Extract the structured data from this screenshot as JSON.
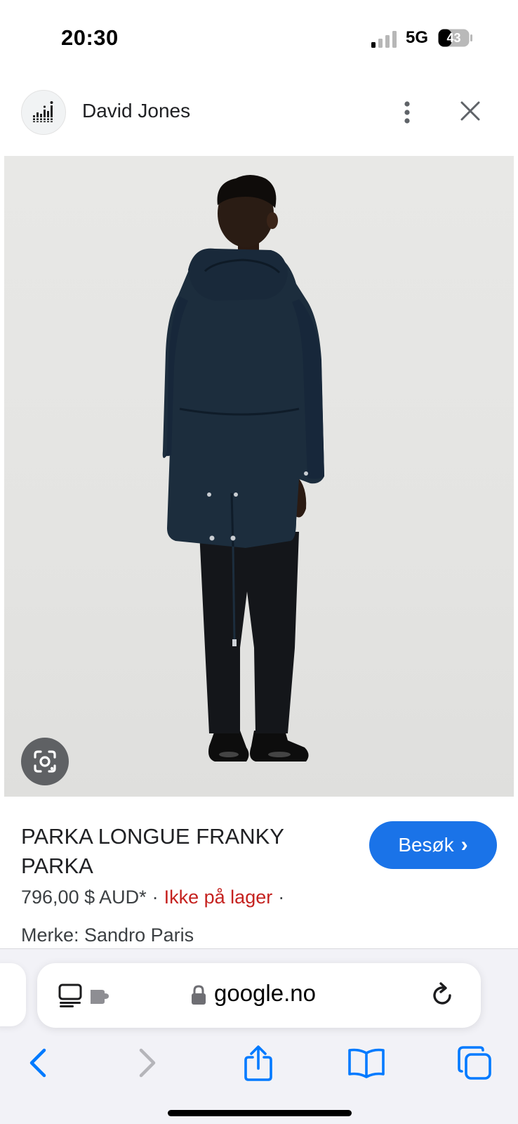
{
  "status_bar": {
    "time": "20:30",
    "network": "5G",
    "battery_level": "43"
  },
  "header": {
    "site_name": "David Jones",
    "logo_icon": "david-jones-logo",
    "more_icon": "more-vert-icon",
    "close_icon": "close-icon"
  },
  "image": {
    "lens_icon": "google-lens-icon"
  },
  "product": {
    "title": "PARKA LONGUE FRANKY PARKA",
    "price": "796,00 $ AUD*",
    "separator": "·",
    "stock_status": "Ikke på lager",
    "brand_line": "Merke: Sandro Paris",
    "visit_label": "Besøk",
    "visit_chevron": "›"
  },
  "browser": {
    "url": "google.no",
    "reader_icon": "reader-mode-icon",
    "extension_icon": "extension-icon",
    "lock_icon": "lock-icon",
    "reload_icon": "reload-icon",
    "toolbar": [
      "back-icon",
      "forward-icon",
      "share-icon",
      "bookmarks-icon",
      "tabs-icon"
    ]
  },
  "colors": {
    "accent": "#1a73e8",
    "stock_status": "#c5221f",
    "safari_blue": "#007aff",
    "coat": "#1c2d3d"
  }
}
